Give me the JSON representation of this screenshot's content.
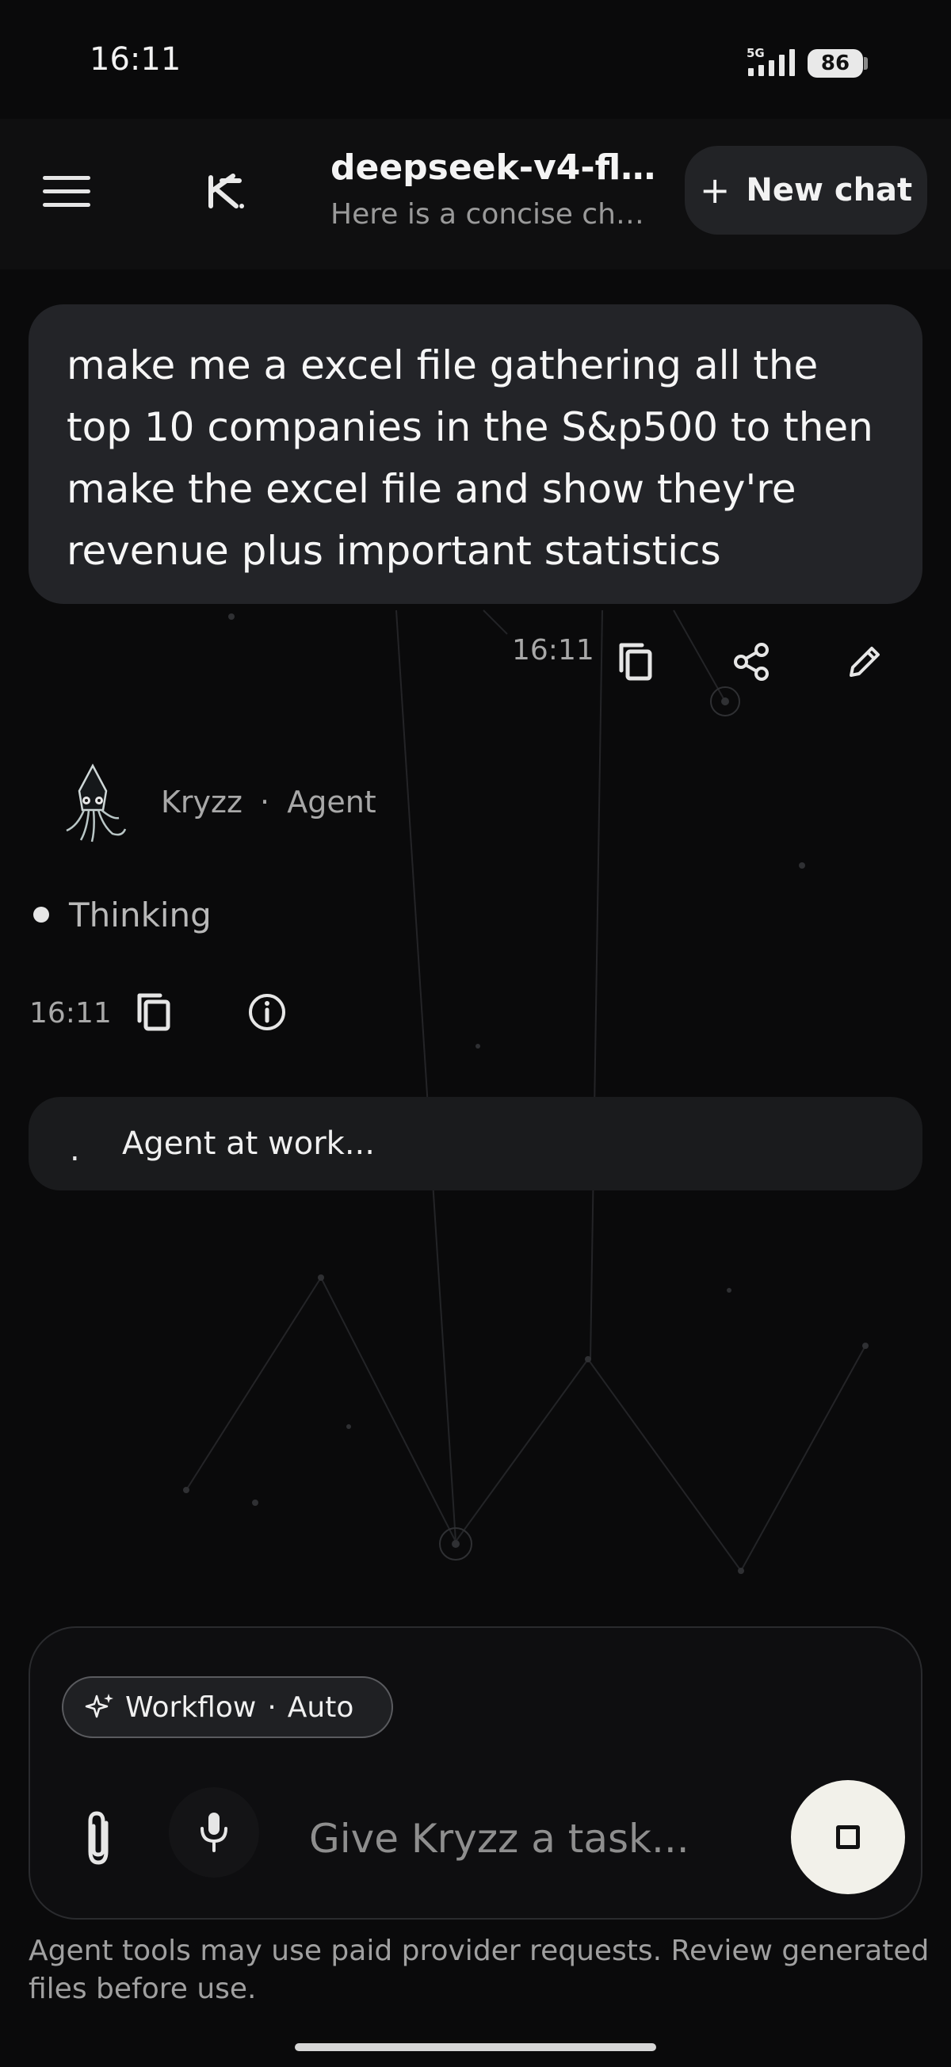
{
  "status_bar": {
    "time": "16:11",
    "network": "5G",
    "battery": "86"
  },
  "header": {
    "title": "deepseek-v4-fl...",
    "subtitle": "Here is a concise cha...",
    "new_chat_label": "New chat"
  },
  "user_message": {
    "text": "make me a excel file gathering all the top 10 companies in the S&p500 to then make the excel file and show they're revenue plus important statistics",
    "time": "16:11"
  },
  "agent": {
    "name": "Kryzz",
    "separator": "·",
    "role": "Agent",
    "status": "Thinking",
    "time": "16:11",
    "work_dot": ".",
    "work_label": "Agent at work..."
  },
  "composer": {
    "mode": "Workflow",
    "separator": "·",
    "mode_setting": "Auto",
    "placeholder": "Give Kryzz a task..."
  },
  "disclaimer": "Agent tools may use paid provider requests. Review generated files before use.",
  "colors": {
    "background": "#0a0a0b",
    "bubble": "#232428",
    "stop_button": "#f2f1ea"
  }
}
